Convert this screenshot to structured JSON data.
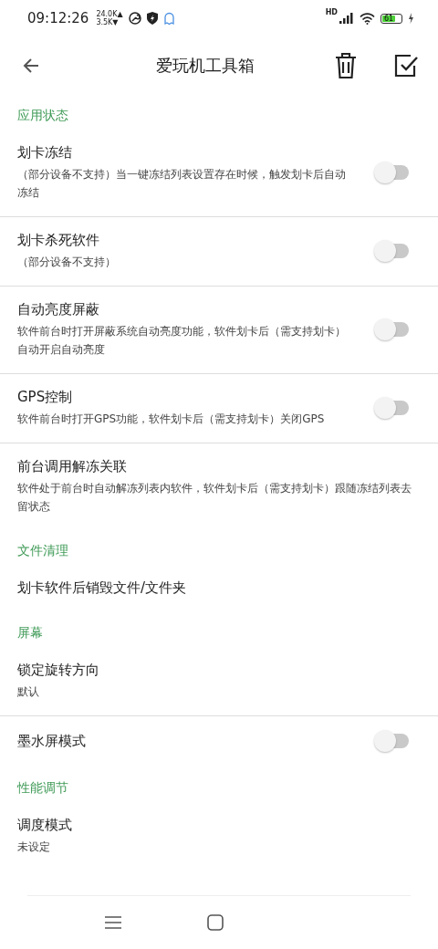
{
  "status_bar": {
    "time": "09:12:26",
    "net_up": "24.0K▲",
    "net_down": "3.5K▼",
    "hd": "HD",
    "battery": "61"
  },
  "app_bar": {
    "title": "爱玩机工具箱"
  },
  "sections": [
    {
      "title": "应用状态",
      "items": [
        {
          "kind": "switch",
          "title": "划卡冻结",
          "description": "（部分设备不支持）当一键冻结列表设置存在时候，触发划卡后自动冻结",
          "on": false
        },
        {
          "kind": "switch",
          "title": "划卡杀死软件",
          "description": "（部分设备不支持）",
          "on": false
        },
        {
          "kind": "switch",
          "title": "自动亮度屏蔽",
          "description": "软件前台时打开屏蔽系统自动亮度功能，软件划卡后（需支持划卡）自动开启自动亮度",
          "on": false
        },
        {
          "kind": "switch",
          "title": "GPS控制",
          "description": "软件前台时打开GPS功能，软件划卡后（需支持划卡）关闭GPS",
          "on": false
        },
        {
          "kind": "plain",
          "title": "前台调用解冻关联",
          "description": "软件处于前台时自动解冻列表内软件，软件划卡后（需支持划卡）跟随冻结列表去留状态"
        }
      ]
    },
    {
      "title": "文件清理",
      "items": [
        {
          "kind": "plain",
          "title": "划卡软件后销毁文件/文件夹"
        }
      ]
    },
    {
      "title": "屏幕",
      "items": [
        {
          "kind": "plain",
          "title": "锁定旋转方向",
          "description": "默认"
        },
        {
          "kind": "switch",
          "title": "墨水屏模式",
          "on": false
        }
      ]
    },
    {
      "title": "性能调节",
      "items": [
        {
          "kind": "plain",
          "title": "调度模式",
          "description": "未设定"
        }
      ]
    }
  ]
}
